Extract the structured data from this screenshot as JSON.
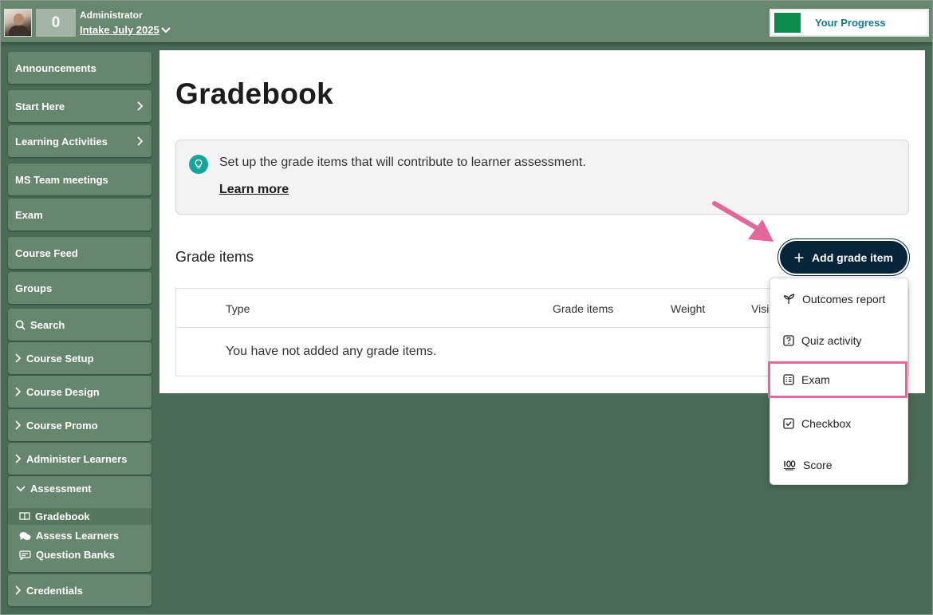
{
  "header": {
    "count": "0",
    "user_role": "Administrator",
    "intake": "Intake July 2025",
    "progress_label": "Your Progress",
    "progress_color": "#0a8a4b"
  },
  "sidebar": {
    "items": [
      {
        "label": "Announcements"
      },
      {
        "label": "Start Here"
      },
      {
        "label": "Learning Activities"
      },
      {
        "label": "MS Team meetings"
      },
      {
        "label": "Exam"
      },
      {
        "label": "Course Feed"
      },
      {
        "label": "Groups"
      },
      {
        "label": "Search"
      },
      {
        "label": "Course Setup"
      },
      {
        "label": "Course Design"
      },
      {
        "label": "Course Promo"
      },
      {
        "label": "Administer Learners"
      },
      {
        "label": "Credentials"
      }
    ],
    "assessment": {
      "label": "Assessment",
      "children": [
        {
          "label": "Gradebook"
        },
        {
          "label": "Assess Learners"
        },
        {
          "label": "Question Banks"
        }
      ]
    }
  },
  "main": {
    "title": "Gradebook",
    "info_text": "Set up the grade items that will contribute to learner assessment.",
    "learn_more": "Learn more",
    "section_title": "Grade items",
    "add_button": "Add grade item",
    "table": {
      "columns": [
        "Type",
        "Grade items",
        "Weight",
        "Visi"
      ],
      "empty_message": "You have not added any grade items."
    }
  },
  "menu": {
    "items": [
      {
        "label": "Outcomes report",
        "icon": "sprout-icon"
      },
      {
        "label": "Quiz activity",
        "icon": "question-box-icon"
      },
      {
        "label": "Exam",
        "icon": "exam-list-icon"
      },
      {
        "label": "Checkbox",
        "icon": "checkbox-icon"
      },
      {
        "label": "Score",
        "icon": "hundred-points-icon"
      }
    ]
  },
  "colors": {
    "background": "#4a6b57",
    "topbar": "#67876f",
    "sidebar_item": "#66866e",
    "primary_button": "#062539",
    "highlight": "#e4679c",
    "accent_teal": "#17a59b"
  }
}
